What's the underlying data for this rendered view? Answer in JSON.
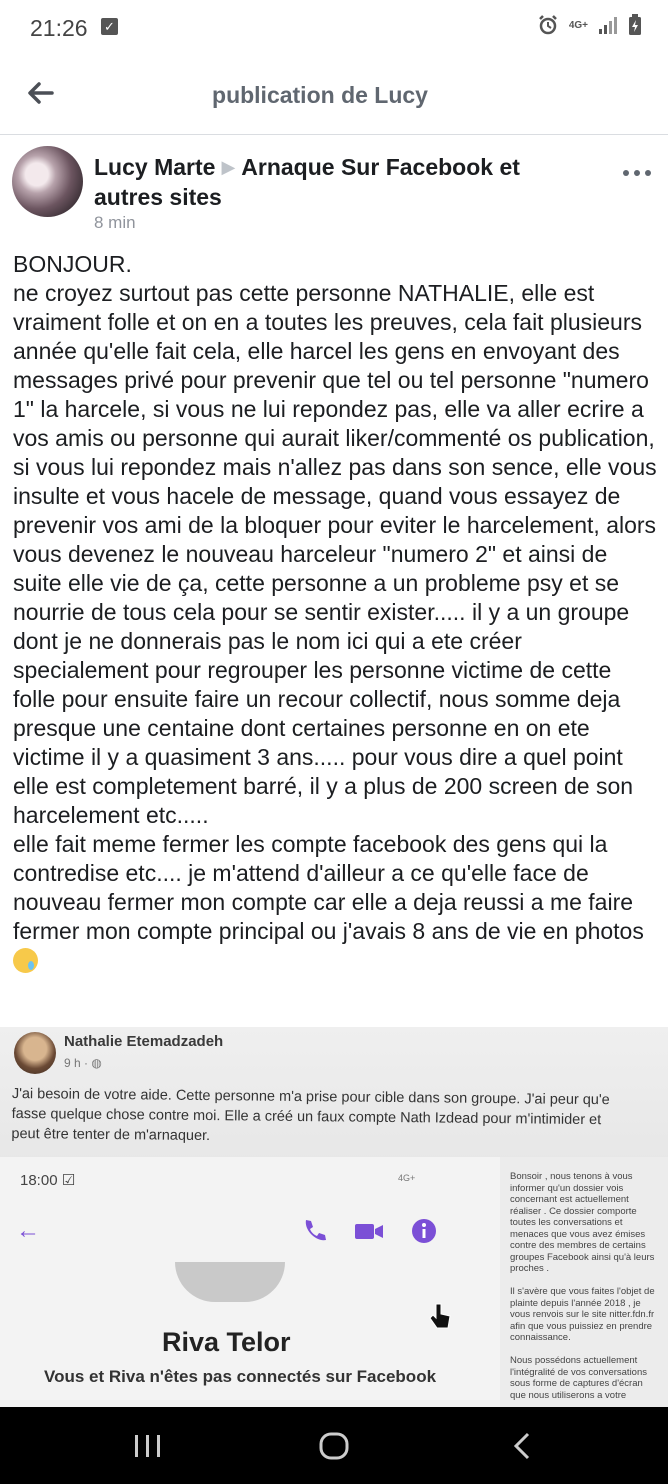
{
  "status_bar": {
    "time": "21:26",
    "network": "4G+"
  },
  "app_bar": {
    "title": "publication de Lucy"
  },
  "post": {
    "author": "Lucy Marte",
    "group": "Arnaque Sur Facebook et autres sites",
    "time_ago": "8 min",
    "text": "BONJOUR.\nne croyez surtout pas cette personne NATHALIE, elle est vraiment folle et on en a toutes les preuves, cela fait plusieurs année qu'elle fait cela, elle harcel les gens en envoyant des messages privé pour prevenir que tel ou tel personne \"numero 1\" la harcele, si vous ne lui repondez pas, elle va aller ecrire a vos amis ou personne qui aurait liker/commenté os publication, si vous lui repondez mais n'allez pas dans son sence, elle vous insulte et vous hacele de message, quand vous essayez de prevenir vos ami de la bloquer pour eviter le harcelement, alors vous devenez le nouveau harceleur \"numero 2\" et ainsi de suite elle vie de ça, cette personne a un probleme psy et se nourrie de tous cela pour se sentir exister..... il y a un groupe dont je ne donnerais pas le nom ici qui a ete créer specialement pour regrouper les personne victime de cette folle pour ensuite faire un recour collectif, nous somme deja presque une centaine dont certaines personne en on ete victime il y a quasiment 3 ans..... pour vous dire a quel point elle est completement barré, il y a plus de 200 screen de son harcelement etc.....\nelle fait meme fermer les compte facebook des gens qui la contredise etc.... je m'attend d'ailleur a ce qu'elle face de nouveau fermer mon compte car elle a deja reussi a me faire fermer mon compte principal ou j'avais 8 ans de vie en photos",
    "emoji": "crying-face"
  },
  "photo": {
    "name": "Nathalie Etemadzadeh",
    "time": "9 h ·",
    "text": "J'ai besoin de votre aide. Cette personne m'a prise pour cible dans son groupe. J'ai peur qu'e\nfasse quelque chose contre moi. Elle a créé un faux compte Nath Izdead pour m'intimider et\npeut être tenter de m'arnaquer.",
    "inner_time": "18:00",
    "inner_network": "4G+",
    "inner_name": "Riva Telor",
    "inner_sub": "Vous et Riva n'êtes pas connectés sur Facebook",
    "side_note": "Bonsoir , nous tenons à vous\ninformer qu'un dossier vois\nconcernant est actuellement\nréaliser . Ce dossier comporte\ntoutes les conversations et\nmenaces que vous avez émises\ncontre des membres de certains\ngroupes Facebook ainsi qu'à leurs\nproches .\n\nIl s'avère que vous faites l'objet de\nplainte depuis l'année 2018 , je\nvous renvois sur le site nitter.fdn.fr\nafin que vous puissiez en prendre\nconnaissance.\n\nNous possédons actuellement\nl'intégralité de vos conversations\nsous forme de captures d'écran\nque nous utiliserons a votre"
  },
  "colors": {
    "accent_purple": "#7b4fd6",
    "muted_text": "#606770"
  }
}
